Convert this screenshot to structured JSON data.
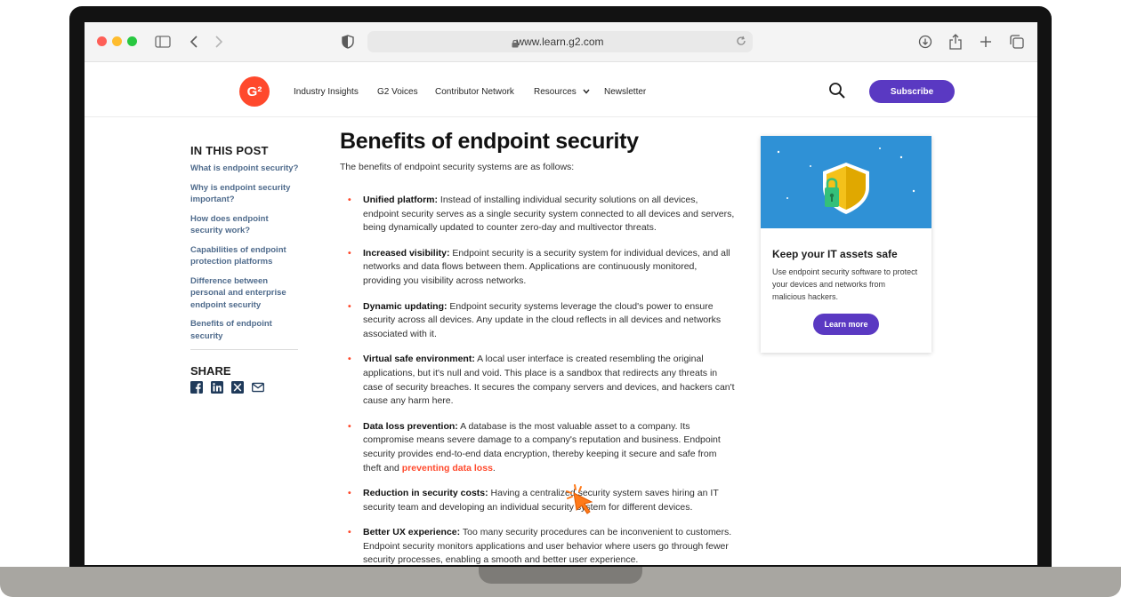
{
  "browser": {
    "url": "www.learn.g2.com"
  },
  "nav": {
    "logo_text": "G²",
    "links": [
      "Industry Insights",
      "G2 Voices",
      "Contributor Network",
      "Resources",
      "Newsletter"
    ],
    "subscribe_label": "Subscribe"
  },
  "toc": {
    "title": "IN THIS POST",
    "items": [
      "What is endpoint security?",
      "Why is endpoint security important?",
      "How does endpoint security work?",
      "Capabilities of endpoint protection platforms",
      "Difference between personal and enterprise endpoint security",
      "Benefits of endpoint security"
    ]
  },
  "share": {
    "title": "SHARE",
    "icons": [
      "facebook-icon",
      "linkedin-icon",
      "x-icon",
      "email-icon"
    ]
  },
  "article": {
    "title": "Benefits of endpoint security",
    "intro": "The benefits of endpoint security systems are as follows:",
    "benefits": [
      {
        "term": "Unified platform:",
        "text": " Instead of installing individual security solutions on all devices, endpoint security serves as a single security system connected to all devices and servers, being dynamically updated to counter zero-day and multivector threats."
      },
      {
        "term": "Increased visibility:",
        "text": " Endpoint security is a security system for individual devices, and all networks and data flows between them. Applications are continuously monitored, providing you visibility across networks."
      },
      {
        "term": "Dynamic updating:",
        "text": " Endpoint security systems leverage the cloud's power to ensure security across all devices. Any update in the cloud reflects in all devices and networks associated with it."
      },
      {
        "term": "Virtual safe environment:",
        "text": " A local user interface is created resembling the original applications, but it's null and void. This place is a sandbox that redirects any threats in case of security breaches. It secures the company servers and devices, and hackers can't cause any harm here."
      },
      {
        "term": "Data loss prevention:",
        "text": " A database is the most valuable asset to a company. Its compromise means severe damage to a company's reputation and business. Endpoint security provides end-to-end data encryption, thereby keeping it secure and safe from theft and ",
        "link": "preventing data loss",
        "after": "."
      },
      {
        "term": "Reduction in security costs:",
        "text": " Having a centralized security system saves hiring an IT security team and developing an individual security system for different devices."
      },
      {
        "term": "Better UX experience:",
        "text": " Too many security procedures can be inconvenient to customers. Endpoint security monitors applications and user behavior where users go through fewer security processes, enabling a smooth and better user experience."
      }
    ]
  },
  "ad": {
    "title": "Keep your IT assets safe",
    "description": "Use endpoint security software to protect your devices and networks from malicious hackers.",
    "button_label": "Learn more"
  },
  "colors": {
    "accent": "#ff492c",
    "brand_purple": "#5a39c2",
    "toc_link": "#4f6b8c",
    "ad_bg": "#2f91d6"
  }
}
